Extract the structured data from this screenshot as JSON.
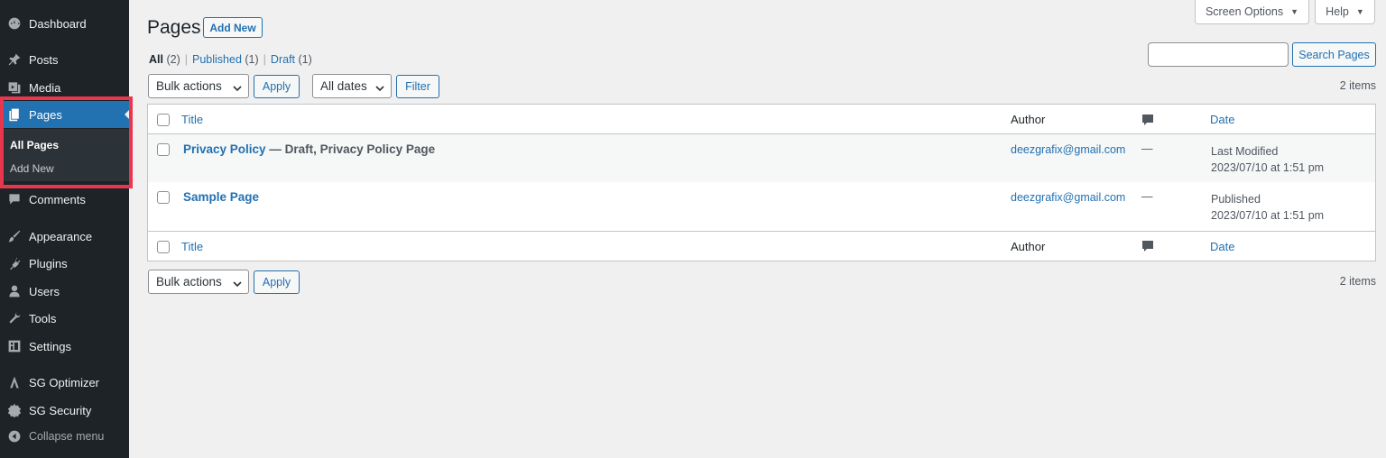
{
  "sidebar": {
    "items": [
      {
        "label": "Dashboard",
        "icon": "dashboard-icon"
      },
      {
        "label": "Posts",
        "icon": "pin-icon"
      },
      {
        "label": "Media",
        "icon": "media-icon"
      },
      {
        "label": "Pages",
        "icon": "pages-icon",
        "active": true
      },
      {
        "label": "Comments",
        "icon": "comment-icon"
      },
      {
        "label": "Appearance",
        "icon": "brush-icon"
      },
      {
        "label": "Plugins",
        "icon": "plug-icon"
      },
      {
        "label": "Users",
        "icon": "user-icon"
      },
      {
        "label": "Tools",
        "icon": "wrench-icon"
      },
      {
        "label": "Settings",
        "icon": "settings-icon"
      },
      {
        "label": "SG Optimizer",
        "icon": "sg-optimizer-icon"
      },
      {
        "label": "SG Security",
        "icon": "sg-security-icon"
      }
    ],
    "submenu": {
      "all_pages": "All Pages",
      "add_new": "Add New"
    },
    "collapse": "Collapse menu",
    "highlight_color": "#e8364f"
  },
  "topbar": {
    "screen_options": "Screen Options",
    "help": "Help"
  },
  "header": {
    "title": "Pages",
    "add_new": "Add New"
  },
  "views": {
    "all": "All",
    "all_count": "(2)",
    "published": "Published",
    "published_count": "(1)",
    "draft": "Draft",
    "draft_count": "(1)",
    "separator": "|"
  },
  "search": {
    "placeholder": "",
    "button": "Search Pages"
  },
  "filters": {
    "bulk_actions": "Bulk actions",
    "apply": "Apply",
    "all_dates": "All dates",
    "filter": "Filter"
  },
  "items_count": "2 items",
  "table": {
    "columns": {
      "title": "Title",
      "author": "Author",
      "date": "Date"
    },
    "rows": [
      {
        "title": "Privacy Policy",
        "state": " — Draft, Privacy Policy Page",
        "author": "deezgrafix@gmail.com",
        "comments": "—",
        "date_status": "Last Modified",
        "date": "2023/07/10 at 1:51 pm"
      },
      {
        "title": "Sample Page",
        "state": "",
        "author": "deezgrafix@gmail.com",
        "comments": "—",
        "date_status": "Published",
        "date": "2023/07/10 at 1:51 pm"
      }
    ]
  },
  "colors": {
    "accent": "#2271b1",
    "sidebar_bg": "#1d2327",
    "page_bg": "#f0f0f1"
  }
}
